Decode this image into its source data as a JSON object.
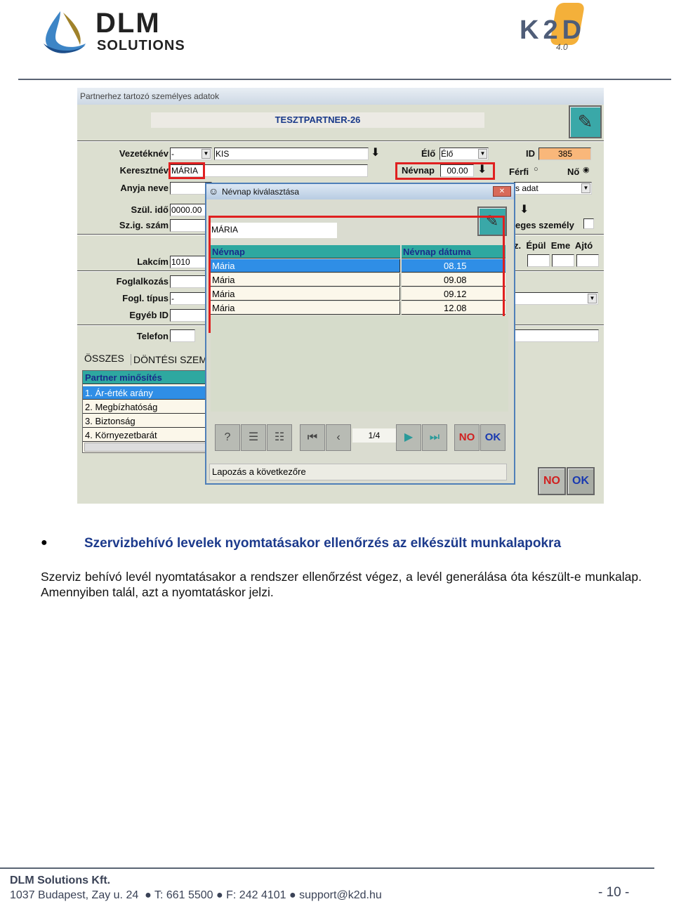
{
  "header": {
    "logo_left": "DLM SOLUTIONS",
    "logo_right": "K2D 4.0"
  },
  "screenshot": {
    "window_title": "Partnerhez tartozó személyes adatok",
    "partner_name": "TESZTPARTNER-26",
    "labels": {
      "vezeteknev": "Vezetéknév",
      "keresztnev": "Keresztnév",
      "anyja_neve": "Anyja neve",
      "szul_ido": "Szül. idő",
      "szig_szam": "Sz.ig. szám",
      "lakcim": "Lakcím",
      "foglalkozas": "Foglalkozás",
      "fogl_tipus": "Fogl. típus",
      "egyeb_id": "Egyéb ID",
      "telefon": "Telefon",
      "elo": "Élő",
      "id": "ID",
      "nevnap": "Névnap",
      "ferfi": "Férfi",
      "no": "Nő",
      "maganszemely": "eges személy",
      "address_cols": "z.  Épül  Eme  Ajtó"
    },
    "values": {
      "title_prefix": "-",
      "vezeteknev": "KIS",
      "keresztnev": "MÁRIA",
      "szul_ido": "0000.00",
      "lakcim": "1010",
      "fogl_tipus": "-",
      "elo": "Élő",
      "id": "385",
      "nevnap": "00.00",
      "adat_select": "s adat",
      "gender": "Nő"
    },
    "tabs": [
      "ÖSSZES",
      "DÖNTÉSI SZEMP"
    ],
    "rating_list": {
      "header": "Partner minősítés",
      "items": [
        "1. Ár-érték arány",
        "2. Megbízhatóság",
        "3. Biztonság",
        "4. Környezetbarát"
      ],
      "selected": 0
    },
    "buttons": {
      "no": "NO",
      "ok": "OK"
    },
    "dialog": {
      "title": "Névnap kiválasztása",
      "search_value": "MÁRIA",
      "columns": [
        "Névnap",
        "Névnap dátuma"
      ],
      "rows": [
        [
          "Mária",
          "08.15"
        ],
        [
          "Mária",
          "09.08"
        ],
        [
          "Mária",
          "09.12"
        ],
        [
          "Mária",
          "12.08"
        ]
      ],
      "selected_row": 0,
      "pager": "1/4",
      "status": "Lapozás a következőre",
      "no": "NO",
      "ok": "OK"
    },
    "colors": {
      "highlight": "#e02020",
      "selection": "#2f8ee6",
      "header_teal": "#2ea8a0",
      "id_bg": "#f9b77a"
    }
  },
  "content": {
    "bullet_heading": "Szervizbehívó levelek nyomtatásakor ellenőrzés az elkészült munkalapokra",
    "paragraph": "Szerviz behívó levél nyomtatásakor a rendszer ellenőrzést végez, a levél generálása óta készült-e munkalap. Amennyiben talál, azt a nyomtatáskor jelzi."
  },
  "footer": {
    "company": "DLM Solutions Kft.",
    "address": "1037 Budapest, Zay u. 24  ● T: 661 5500 ● F: 242 4101 ● support@k2d.hu",
    "page": "- 10 -"
  }
}
